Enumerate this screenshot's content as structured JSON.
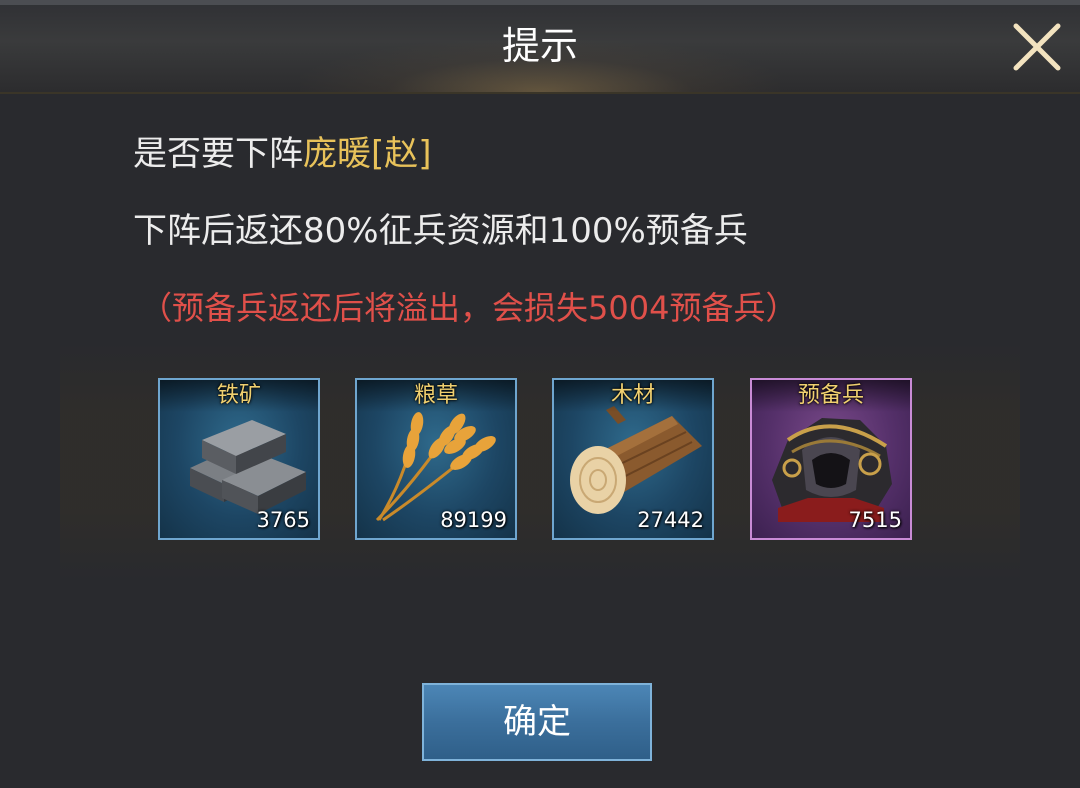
{
  "dialog": {
    "title": "提示",
    "close_icon": "close-icon",
    "message_prefix": "是否要下阵",
    "general_name": "庞暖[赵]",
    "message_line2": "下阵后返还80%征兵资源和100%预备兵",
    "warning": "（预备兵返还后将溢出，会损失5004预备兵）",
    "confirm_label": "确定"
  },
  "resources": [
    {
      "label": "铁矿",
      "value": "3765",
      "icon": "iron-ingot-icon"
    },
    {
      "label": "粮草",
      "value": "89199",
      "icon": "wheat-icon"
    },
    {
      "label": "木材",
      "value": "27442",
      "icon": "wood-log-icon"
    },
    {
      "label": "预备兵",
      "value": "7515",
      "icon": "armor-helmet-icon"
    }
  ],
  "colors": {
    "accent_gold": "#e8c25a",
    "warning_red": "#e0504a",
    "button_blue": "#3b6f9c"
  }
}
